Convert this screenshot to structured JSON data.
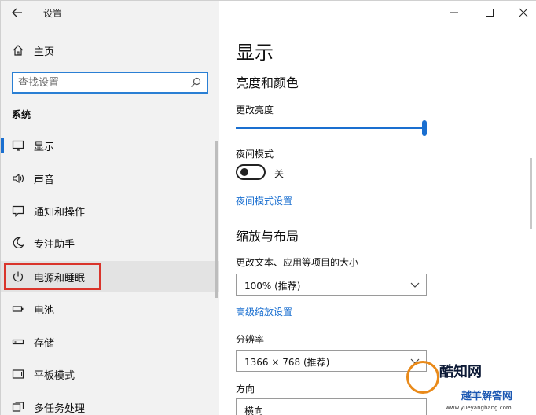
{
  "window": {
    "title": "设置"
  },
  "sidebar": {
    "home_label": "主页",
    "search_placeholder": "查找设置",
    "section_title": "系统",
    "items": [
      {
        "label": "显示",
        "icon": "monitor-icon"
      },
      {
        "label": "声音",
        "icon": "speaker-icon"
      },
      {
        "label": "通知和操作",
        "icon": "notification-icon"
      },
      {
        "label": "专注助手",
        "icon": "moon-icon"
      },
      {
        "label": "电源和睡眠",
        "icon": "power-icon"
      },
      {
        "label": "电池",
        "icon": "battery-icon"
      },
      {
        "label": "存储",
        "icon": "storage-icon"
      },
      {
        "label": "平板模式",
        "icon": "tablet-icon"
      },
      {
        "label": "多任务处理",
        "icon": "multitask-icon"
      }
    ],
    "active_index": 0,
    "highlight_index": 4
  },
  "main": {
    "page_title": "显示",
    "brightness_heading": "亮度和颜色",
    "brightness_label": "更改亮度",
    "brightness_value": 1.0,
    "night_mode_label": "夜间模式",
    "night_mode_state": "关",
    "night_mode_link": "夜间模式设置",
    "scale_heading": "缩放与布局",
    "scale_label": "更改文本、应用等项目的大小",
    "scale_value": "100% (推荐)",
    "advanced_scale_link": "高级缩放设置",
    "resolution_label": "分辨率",
    "resolution_value": "1366 × 768 (推荐)",
    "orientation_label": "方向",
    "orientation_value": "横向"
  },
  "watermark": {
    "text1": "酷知网",
    "text2": "越羊解答网",
    "url": "www.yueyangbang.com"
  },
  "colors": {
    "accent": "#1a6fd0",
    "sidebar_bg": "#f2f2f2",
    "highlight_border": "#d9342b"
  }
}
